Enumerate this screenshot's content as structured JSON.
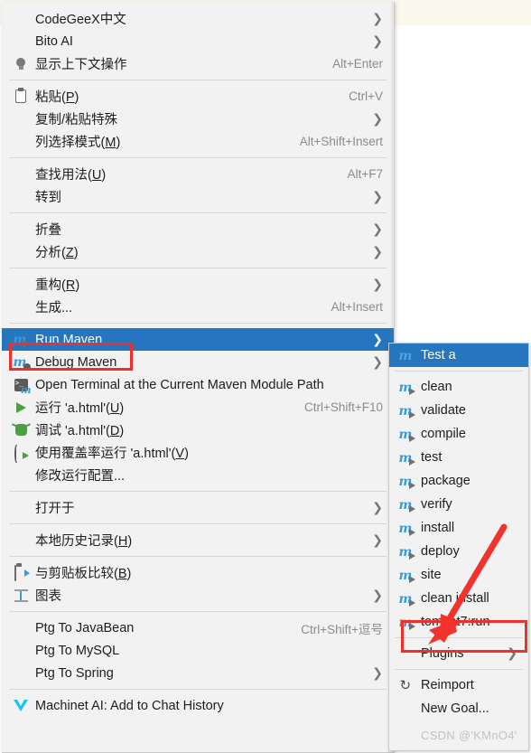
{
  "app": {
    "context": "intellij-idea-editor-context-menu",
    "watermark": "CSDN @'KMnO4'",
    "colors": {
      "menu_bg": "#f2f2f2",
      "selection": "#2675bf",
      "text": "#1d1d1d",
      "accel_text": "#8b8b8b",
      "annotation_red": "#ef2f29",
      "maven_blue": "#3a9ad9",
      "editor_cream": "#faf7ec"
    }
  },
  "main_menu": {
    "groups": [
      {
        "items": [
          {
            "label": "CodeGeeX中文",
            "icon": "none",
            "accel": "",
            "arrow": true,
            "selected": false
          },
          {
            "label": "Bito AI",
            "icon": "none",
            "accel": "",
            "arrow": true,
            "selected": false
          },
          {
            "label": "显示上下文操作",
            "icon": "lightbulb-icon",
            "accel": "Alt+Enter",
            "arrow": false,
            "selected": false
          }
        ]
      },
      {
        "items": [
          {
            "label": "粘贴(P)",
            "mnemonic": "P",
            "icon": "clipboard-icon",
            "accel": "Ctrl+V",
            "arrow": false,
            "selected": false
          },
          {
            "label": "复制/粘贴特殊",
            "icon": "none",
            "accel": "",
            "arrow": true,
            "selected": false
          },
          {
            "label": "列选择模式(M)",
            "mnemonic": "M",
            "icon": "none",
            "accel": "Alt+Shift+Insert",
            "arrow": false,
            "selected": false
          }
        ]
      },
      {
        "items": [
          {
            "label": "查找用法(U)",
            "mnemonic": "U",
            "icon": "none",
            "accel": "Alt+F7",
            "arrow": false,
            "selected": false
          },
          {
            "label": "转到",
            "icon": "none",
            "accel": "",
            "arrow": true,
            "selected": false
          }
        ]
      },
      {
        "items": [
          {
            "label": "折叠",
            "icon": "none",
            "accel": "",
            "arrow": true,
            "selected": false
          },
          {
            "label": "分析(Z)",
            "mnemonic": "Z",
            "icon": "none",
            "accel": "",
            "arrow": true,
            "selected": false
          }
        ]
      },
      {
        "items": [
          {
            "label": "重构(R)",
            "mnemonic": "R",
            "icon": "none",
            "accel": "",
            "arrow": true,
            "selected": false
          },
          {
            "label": "生成...",
            "icon": "none",
            "accel": "Alt+Insert",
            "arrow": false,
            "selected": false
          }
        ]
      },
      {
        "items": [
          {
            "label": "Run Maven",
            "icon": "maven-run-icon",
            "accel": "",
            "arrow": true,
            "selected": true,
            "highlighted_box": true
          },
          {
            "label": "Debug Maven",
            "icon": "maven-debug-icon",
            "accel": "",
            "arrow": true,
            "selected": false
          },
          {
            "label": "Open Terminal at the Current Maven Module Path",
            "icon": "terminal-maven-icon",
            "accel": "",
            "arrow": false,
            "selected": false
          },
          {
            "label": "运行 'a.html'(U)",
            "mnemonic": "U",
            "icon": "green-play-icon",
            "accel": "Ctrl+Shift+F10",
            "arrow": false,
            "selected": false
          },
          {
            "label": "调试 'a.html'(D)",
            "mnemonic": "D",
            "icon": "green-bug-icon",
            "accel": "",
            "arrow": false,
            "selected": false
          },
          {
            "label": "使用覆盖率运行 'a.html'(V)",
            "mnemonic": "V",
            "icon": "coverage-run-icon",
            "accel": "",
            "arrow": false,
            "selected": false
          },
          {
            "label": "修改运行配置...",
            "icon": "none",
            "accel": "",
            "arrow": false,
            "selected": false
          }
        ]
      },
      {
        "items": [
          {
            "label": "打开于",
            "icon": "none",
            "accel": "",
            "arrow": true,
            "selected": false
          }
        ]
      },
      {
        "items": [
          {
            "label": "本地历史记录(H)",
            "mnemonic": "H",
            "icon": "none",
            "accel": "",
            "arrow": true,
            "selected": false
          }
        ]
      },
      {
        "items": [
          {
            "label": "与剪贴板比较(B)",
            "mnemonic": "B",
            "icon": "clipboard-diff-icon",
            "accel": "",
            "arrow": false,
            "selected": false
          },
          {
            "label": "图表",
            "icon": "diagram-icon",
            "accel": "",
            "arrow": true,
            "selected": false
          }
        ]
      },
      {
        "items": [
          {
            "label": "Ptg To JavaBean",
            "icon": "none",
            "accel": "Ctrl+Shift+逗号",
            "arrow": false,
            "selected": false
          },
          {
            "label": "Ptg To MySQL",
            "icon": "none",
            "accel": "",
            "arrow": false,
            "selected": false
          },
          {
            "label": "Ptg To Spring",
            "icon": "none",
            "accel": "",
            "arrow": true,
            "selected": false
          }
        ]
      },
      {
        "items": [
          {
            "label": "Machinet AI: Add to Chat History",
            "icon": "machinet-icon",
            "accel": "",
            "arrow": false,
            "selected": false
          }
        ]
      }
    ]
  },
  "sub_menu": {
    "title": "Run Maven",
    "groups": [
      {
        "items": [
          {
            "label": "Test a",
            "icon": "maven-module-icon",
            "accel": "",
            "arrow": false,
            "selected": true
          }
        ]
      },
      {
        "items": [
          {
            "label": "clean",
            "icon": "maven-goal-icon",
            "accel": "",
            "arrow": false,
            "selected": false
          },
          {
            "label": "validate",
            "icon": "maven-goal-icon",
            "accel": "",
            "arrow": false,
            "selected": false
          },
          {
            "label": "compile",
            "icon": "maven-goal-icon",
            "accel": "",
            "arrow": false,
            "selected": false
          },
          {
            "label": "test",
            "icon": "maven-goal-icon",
            "accel": "",
            "arrow": false,
            "selected": false
          },
          {
            "label": "package",
            "icon": "maven-goal-icon",
            "accel": "",
            "arrow": false,
            "selected": false
          },
          {
            "label": "verify",
            "icon": "maven-goal-icon",
            "accel": "",
            "arrow": false,
            "selected": false
          },
          {
            "label": "install",
            "icon": "maven-goal-icon",
            "accel": "",
            "arrow": false,
            "selected": false
          },
          {
            "label": "deploy",
            "icon": "maven-goal-icon",
            "accel": "",
            "arrow": false,
            "selected": false
          },
          {
            "label": "site",
            "icon": "maven-goal-icon",
            "accel": "",
            "arrow": false,
            "selected": false
          },
          {
            "label": "clean install",
            "icon": "maven-goal-icon",
            "accel": "",
            "arrow": false,
            "selected": false
          },
          {
            "label": "tomcat7:run",
            "icon": "maven-goal-icon",
            "accel": "",
            "arrow": false,
            "selected": false,
            "highlighted_box": true
          }
        ]
      },
      {
        "items": [
          {
            "label": "Plugins",
            "icon": "none",
            "accel": "",
            "arrow": true,
            "selected": false
          }
        ]
      },
      {
        "items": [
          {
            "label": "Reimport",
            "icon": "reimport-icon",
            "accel": "",
            "arrow": false,
            "selected": false
          },
          {
            "label": "New Goal...",
            "icon": "none",
            "accel": "",
            "arrow": false,
            "selected": false
          }
        ]
      }
    ]
  },
  "annotations": {
    "arrow": {
      "name": "red-arrow-pointing-to-tomcat7-run",
      "color": "#f4322c"
    },
    "boxes": [
      {
        "name": "red-box-run-maven",
        "target": "Run Maven"
      },
      {
        "name": "red-box-tomcat7-run",
        "target": "tomcat7:run"
      }
    ]
  }
}
